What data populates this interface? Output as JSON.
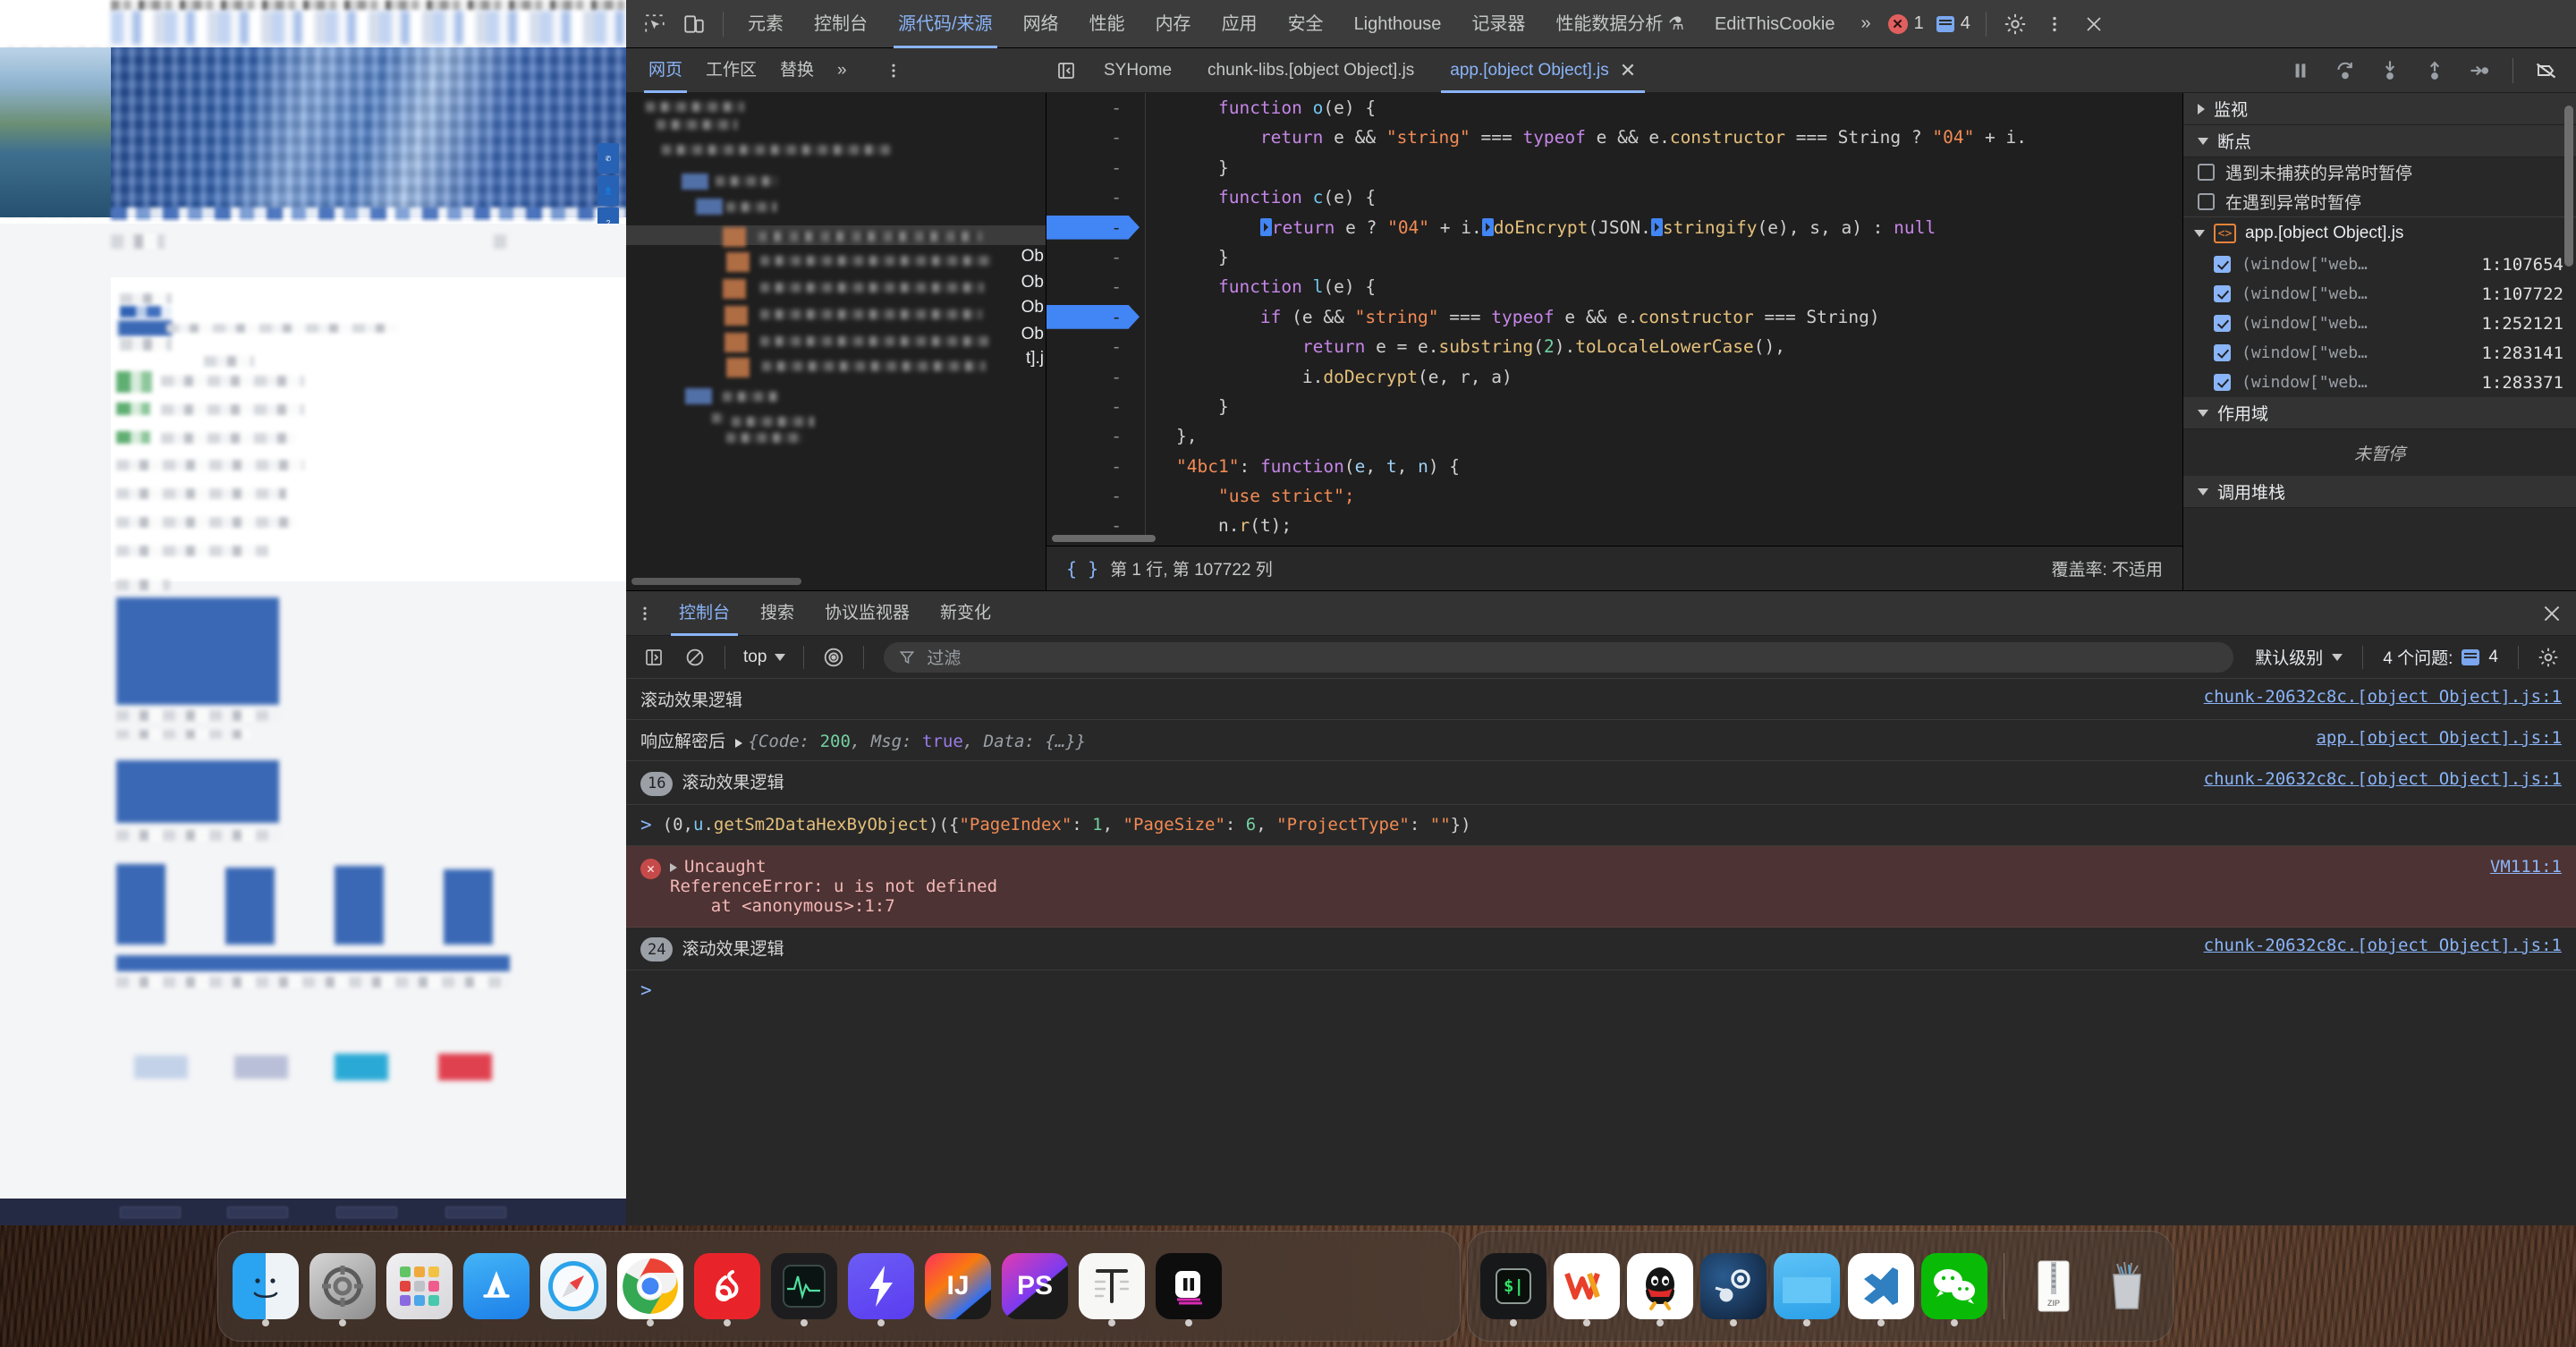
{
  "devtools": {
    "main_tabs": [
      {
        "label": "元素",
        "active": false
      },
      {
        "label": "控制台",
        "active": false
      },
      {
        "label": "源代码/来源",
        "active": true
      },
      {
        "label": "网络",
        "active": false
      },
      {
        "label": "性能",
        "active": false
      },
      {
        "label": "内存",
        "active": false
      },
      {
        "label": "应用",
        "active": false
      },
      {
        "label": "安全",
        "active": false
      },
      {
        "label": "Lighthouse",
        "active": false
      },
      {
        "label": "记录器",
        "active": false
      },
      {
        "label": "性能数据分析 ⚗",
        "active": false
      },
      {
        "label": "EditThisCookie",
        "active": false
      }
    ],
    "overflow_label": "»",
    "error_count": "1",
    "message_count": "4",
    "inspect_icon": "inspect-element-icon",
    "device_icon": "device-toolbar-icon",
    "settings_icon": "gear-icon",
    "more_icon": "kebab-menu-icon",
    "close_icon": "close-icon"
  },
  "sources": {
    "nav_tabs": [
      {
        "label": "网页",
        "active": true
      },
      {
        "label": "工作区",
        "active": false
      },
      {
        "label": "替换",
        "active": false
      },
      {
        "label": "»",
        "active": false
      }
    ],
    "nav_more_icon": "kebab-menu-icon",
    "panel_toggle_icon": "show-navigator-icon",
    "file_tabs": [
      {
        "label": "SYHome",
        "active": false,
        "closable": false
      },
      {
        "label": "chunk-libs.[object Object].js",
        "active": false,
        "closable": false
      },
      {
        "label": "app.[object Object].js",
        "active": true,
        "closable": true
      }
    ],
    "debug_buttons": [
      {
        "name": "pause-resume-button",
        "glyph": "pause"
      },
      {
        "name": "step-over-button",
        "glyph": "step-over"
      },
      {
        "name": "step-into-button",
        "glyph": "step-into"
      },
      {
        "name": "step-out-button",
        "glyph": "step-out"
      },
      {
        "name": "step-button",
        "glyph": "step"
      },
      {
        "name": "deactivate-breakpoints-button",
        "glyph": "bp-off"
      }
    ],
    "status": {
      "format_icon": "pretty-print-icon",
      "position": "第 1 行, 第 107722 列",
      "coverage": "覆盖率: 不适用"
    }
  },
  "code": {
    "lines": [
      {
        "gutter": "-",
        "breakpoint": false,
        "indent": 2,
        "tokens": [
          {
            "t": "function ",
            "c": "kw"
          },
          {
            "t": "o",
            "c": "fn"
          },
          {
            "t": "(e) {",
            "c": "plain"
          }
        ]
      },
      {
        "gutter": "-",
        "breakpoint": false,
        "indent": 3,
        "tokens": [
          {
            "t": "return",
            "c": "kw"
          },
          {
            "t": " e && ",
            "c": "plain"
          },
          {
            "t": "\"string\"",
            "c": "str"
          },
          {
            "t": " === ",
            "c": "plain"
          },
          {
            "t": "typeof",
            "c": "kw"
          },
          {
            "t": " e && e.",
            "c": "plain"
          },
          {
            "t": "constructor",
            "c": "prop"
          },
          {
            "t": " === String ? ",
            "c": "plain"
          },
          {
            "t": "\"04\"",
            "c": "str"
          },
          {
            "t": " + i.",
            "c": "plain"
          }
        ]
      },
      {
        "gutter": "-",
        "breakpoint": false,
        "indent": 2,
        "tokens": [
          {
            "t": "}",
            "c": "plain"
          }
        ]
      },
      {
        "gutter": "-",
        "breakpoint": false,
        "indent": 2,
        "tokens": [
          {
            "t": "function ",
            "c": "kw"
          },
          {
            "t": "c",
            "c": "fn"
          },
          {
            "t": "(e) {",
            "c": "plain"
          }
        ]
      },
      {
        "gutter": "-",
        "breakpoint": true,
        "indent": 3,
        "tokens": [
          {
            "t": "§",
            "c": "btn"
          },
          {
            "t": "return",
            "c": "kw"
          },
          {
            "t": " e ? ",
            "c": "plain"
          },
          {
            "t": "\"04\"",
            "c": "str"
          },
          {
            "t": " + i.",
            "c": "plain"
          },
          {
            "t": "§",
            "c": "btn"
          },
          {
            "t": "doEncrypt",
            "c": "prop"
          },
          {
            "t": "(JSON.",
            "c": "plain"
          },
          {
            "t": "§",
            "c": "btn"
          },
          {
            "t": "stringify",
            "c": "prop"
          },
          {
            "t": "(e), s, a) : ",
            "c": "plain"
          },
          {
            "t": "null",
            "c": "lit"
          }
        ]
      },
      {
        "gutter": "-",
        "breakpoint": false,
        "indent": 2,
        "tokens": [
          {
            "t": "}",
            "c": "plain"
          }
        ]
      },
      {
        "gutter": "-",
        "breakpoint": false,
        "indent": 2,
        "tokens": [
          {
            "t": "function ",
            "c": "kw"
          },
          {
            "t": "l",
            "c": "fn"
          },
          {
            "t": "(e) {",
            "c": "plain"
          }
        ]
      },
      {
        "gutter": "-",
        "breakpoint": true,
        "indent": 3,
        "tokens": [
          {
            "t": "if",
            "c": "kw"
          },
          {
            "t": " (e && ",
            "c": "plain"
          },
          {
            "t": "\"string\"",
            "c": "str"
          },
          {
            "t": " === ",
            "c": "plain"
          },
          {
            "t": "typeof",
            "c": "kw"
          },
          {
            "t": " e && e.",
            "c": "plain"
          },
          {
            "t": "constructor",
            "c": "prop"
          },
          {
            "t": " === String)",
            "c": "plain"
          }
        ]
      },
      {
        "gutter": "-",
        "breakpoint": false,
        "indent": 4,
        "tokens": [
          {
            "t": "return",
            "c": "kw"
          },
          {
            "t": " e = e.",
            "c": "plain"
          },
          {
            "t": "substring",
            "c": "prop"
          },
          {
            "t": "(",
            "c": "plain"
          },
          {
            "t": "2",
            "c": "num"
          },
          {
            "t": ").",
            "c": "plain"
          },
          {
            "t": "toLocaleLowerCase",
            "c": "prop"
          },
          {
            "t": "(),",
            "c": "plain"
          }
        ]
      },
      {
        "gutter": "-",
        "breakpoint": false,
        "indent": 4,
        "tokens": [
          {
            "t": "i.",
            "c": "plain"
          },
          {
            "t": "doDecrypt",
            "c": "prop"
          },
          {
            "t": "(e, r, a)",
            "c": "plain"
          }
        ]
      },
      {
        "gutter": "-",
        "breakpoint": false,
        "indent": 2,
        "tokens": [
          {
            "t": "}",
            "c": "plain"
          }
        ]
      },
      {
        "gutter": "-",
        "breakpoint": false,
        "indent": 1,
        "tokens": [
          {
            "t": "},",
            "c": "plain"
          }
        ]
      },
      {
        "gutter": "-",
        "breakpoint": false,
        "indent": 1,
        "tokens": [
          {
            "t": "\"4bc1\"",
            "c": "str"
          },
          {
            "t": ": ",
            "c": "plain"
          },
          {
            "t": "function",
            "c": "kw"
          },
          {
            "t": "(",
            "c": "plain"
          },
          {
            "t": "e",
            "c": "param"
          },
          {
            "t": ", ",
            "c": "plain"
          },
          {
            "t": "t",
            "c": "param"
          },
          {
            "t": ", ",
            "c": "plain"
          },
          {
            "t": "n",
            "c": "param"
          },
          {
            "t": ") {",
            "c": "plain"
          }
        ]
      },
      {
        "gutter": "-",
        "breakpoint": false,
        "indent": 2,
        "tokens": [
          {
            "t": "\"use strict\";",
            "c": "str"
          }
        ]
      },
      {
        "gutter": "-",
        "breakpoint": false,
        "indent": 2,
        "tokens": [
          {
            "t": "n.",
            "c": "plain"
          },
          {
            "t": "r",
            "c": "prop"
          },
          {
            "t": "(t);",
            "c": "plain"
          }
        ]
      }
    ]
  },
  "debugger_sidebar": {
    "watch_label": "监视",
    "breakpoints_label": "断点",
    "pause_uncaught_label": "遇到未捕获的异常时暂停",
    "pause_caught_label": "在遇到异常时暂停",
    "pause_uncaught_checked": false,
    "pause_caught_checked": false,
    "file_label": "app.[object Object].js",
    "breakpoints": [
      {
        "text": "(window[\"web…",
        "location": "1:107654",
        "checked": true
      },
      {
        "text": "(window[\"web…",
        "location": "1:107722",
        "checked": true
      },
      {
        "text": "(window[\"web…",
        "location": "1:252121",
        "checked": true
      },
      {
        "text": "(window[\"web…",
        "location": "1:283141",
        "checked": true
      },
      {
        "text": "(window[\"web…",
        "location": "1:283371",
        "checked": true
      }
    ],
    "scope_label": "作用域",
    "scope_empty": "未暂停",
    "callstack_label": "调用堆栈"
  },
  "drawer": {
    "tabs": [
      {
        "label": "控制台",
        "active": true
      },
      {
        "label": "搜索",
        "active": false
      },
      {
        "label": "协议监视器",
        "active": false
      },
      {
        "label": "新变化",
        "active": false
      }
    ],
    "kebab_icon": "kebab-menu-icon",
    "close_icon": "close-icon"
  },
  "console_toolbar": {
    "sidebar_icon": "console-sidebar-icon",
    "clear_icon": "clear-console-icon",
    "context": "top",
    "eye_icon": "live-expression-icon",
    "filter_icon": "filter-icon",
    "filter_placeholder": "过滤",
    "level": "默认级别",
    "issues_text": "4 个问题:",
    "issues_count": "4",
    "settings_icon": "gear-icon"
  },
  "console_logs": [
    {
      "type": "log",
      "count": null,
      "text": "滚动效果逻辑",
      "source": "chunk-20632c8c.[object Object].js:1"
    },
    {
      "type": "object",
      "count": null,
      "label": "响应解密后",
      "source": "app.[object Object].js:1",
      "object": {
        "prefix": "{",
        "suffix": "}",
        "entries": [
          {
            "key": "Code",
            "value": "200",
            "kind": "num"
          },
          {
            "key": "Msg",
            "value": "true",
            "kind": "bool"
          },
          {
            "key": "Data",
            "value": "{…}",
            "kind": "obj"
          }
        ]
      }
    },
    {
      "type": "log",
      "count": "16",
      "text": "滚动效果逻辑",
      "source": "chunk-20632c8c.[object Object].js:1"
    },
    {
      "type": "input",
      "text": "(0,u.getSm2DataHexByObject)({\"PageIndex\": 1, \"PageSize\": 6, \"ProjectType\": \"\"})",
      "source": ""
    },
    {
      "type": "error",
      "title": "Uncaught",
      "lines": [
        "ReferenceError: u is not defined",
        "    at <anonymous>:1:7"
      ],
      "source": "VM111:1"
    },
    {
      "type": "log",
      "count": "24",
      "text": "滚动效果逻辑",
      "source": "chunk-20632c8c.[object Object].js:1"
    },
    {
      "type": "prompt",
      "text": "",
      "source": ""
    }
  ],
  "dock_left": [
    {
      "name": "finder",
      "label": "",
      "running": true
    },
    {
      "name": "system-settings",
      "label": "",
      "running": true
    },
    {
      "name": "launchpad",
      "label": "",
      "running": false
    },
    {
      "name": "app-store",
      "label": "",
      "running": false
    },
    {
      "name": "safari",
      "label": "",
      "running": false
    },
    {
      "name": "google-chrome",
      "label": "",
      "running": true
    },
    {
      "name": "netease-music",
      "label": "",
      "running": true
    },
    {
      "name": "activity-monitor",
      "label": "",
      "running": true
    },
    {
      "name": "charles",
      "label": "",
      "running": true
    },
    {
      "name": "intellij-idea",
      "label": "IJ",
      "running": false
    },
    {
      "name": "photoshop",
      "label": "PS",
      "running": false
    },
    {
      "name": "typora",
      "label": "T",
      "running": true
    },
    {
      "name": "obs-studio",
      "label": "",
      "running": true
    }
  ],
  "dock_right": [
    {
      "name": "terminal",
      "label": "$",
      "running": true
    },
    {
      "name": "wps-office",
      "label": "W",
      "running": true
    },
    {
      "name": "qq",
      "label": "",
      "running": true
    },
    {
      "name": "steam",
      "label": "",
      "running": true
    },
    {
      "name": "folder",
      "label": "",
      "running": true
    },
    {
      "name": "vs-code",
      "label": "X",
      "running": true
    },
    {
      "name": "wechat",
      "label": "",
      "running": true
    }
  ],
  "dock_extras": [
    {
      "name": "zip-archive",
      "label": "ZIP"
    },
    {
      "name": "trash",
      "label": ""
    }
  ]
}
